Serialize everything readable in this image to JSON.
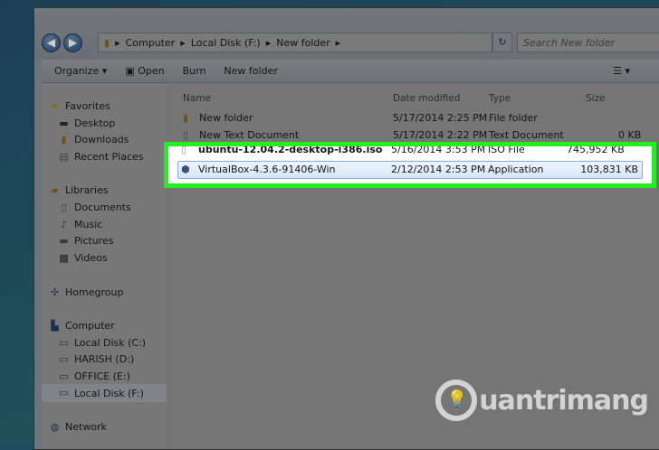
{
  "address": {
    "crumbs": [
      "Computer",
      "Local Disk (F:)",
      "New folder"
    ],
    "search_placeholder": "Search New folder"
  },
  "toolbar": {
    "organize": "Organize ▾",
    "open": "Open",
    "burn": "Burn",
    "new_folder": "New folder"
  },
  "sidebar": {
    "favorites": "Favorites",
    "desktop": "Desktop",
    "downloads": "Downloads",
    "recent": "Recent Places",
    "libraries": "Libraries",
    "documents": "Documents",
    "music": "Music",
    "pictures": "Pictures",
    "videos": "Videos",
    "homegroup": "Homegroup",
    "computer": "Computer",
    "c": "Local Disk (C:)",
    "d": "HARISH (D:)",
    "e": "OFFICE (E:)",
    "f": "Local Disk (F:)",
    "network": "Network"
  },
  "columns": {
    "name": "Name",
    "date": "Date modified",
    "type": "Type",
    "size": "Size"
  },
  "files": [
    {
      "name": "New folder",
      "date": "5/17/2014 2:25 PM",
      "type": "File folder",
      "size": ""
    },
    {
      "name": "New Text Document",
      "date": "5/17/2014 2:22 PM",
      "type": "Text Document",
      "size": "0 KB"
    },
    {
      "name": "ubuntu-12.04.2-desktop-i386.iso",
      "date": "5/16/2014 3:53 PM",
      "type": "ISO File",
      "size": "745,952 KB"
    },
    {
      "name": "VirtualBox-4.3.6-91406-Win",
      "date": "2/12/2014 2:53 PM",
      "type": "Application",
      "size": "103,831 KB"
    }
  ],
  "watermark": "uantrimang",
  "highlight_color": "#22ee22"
}
